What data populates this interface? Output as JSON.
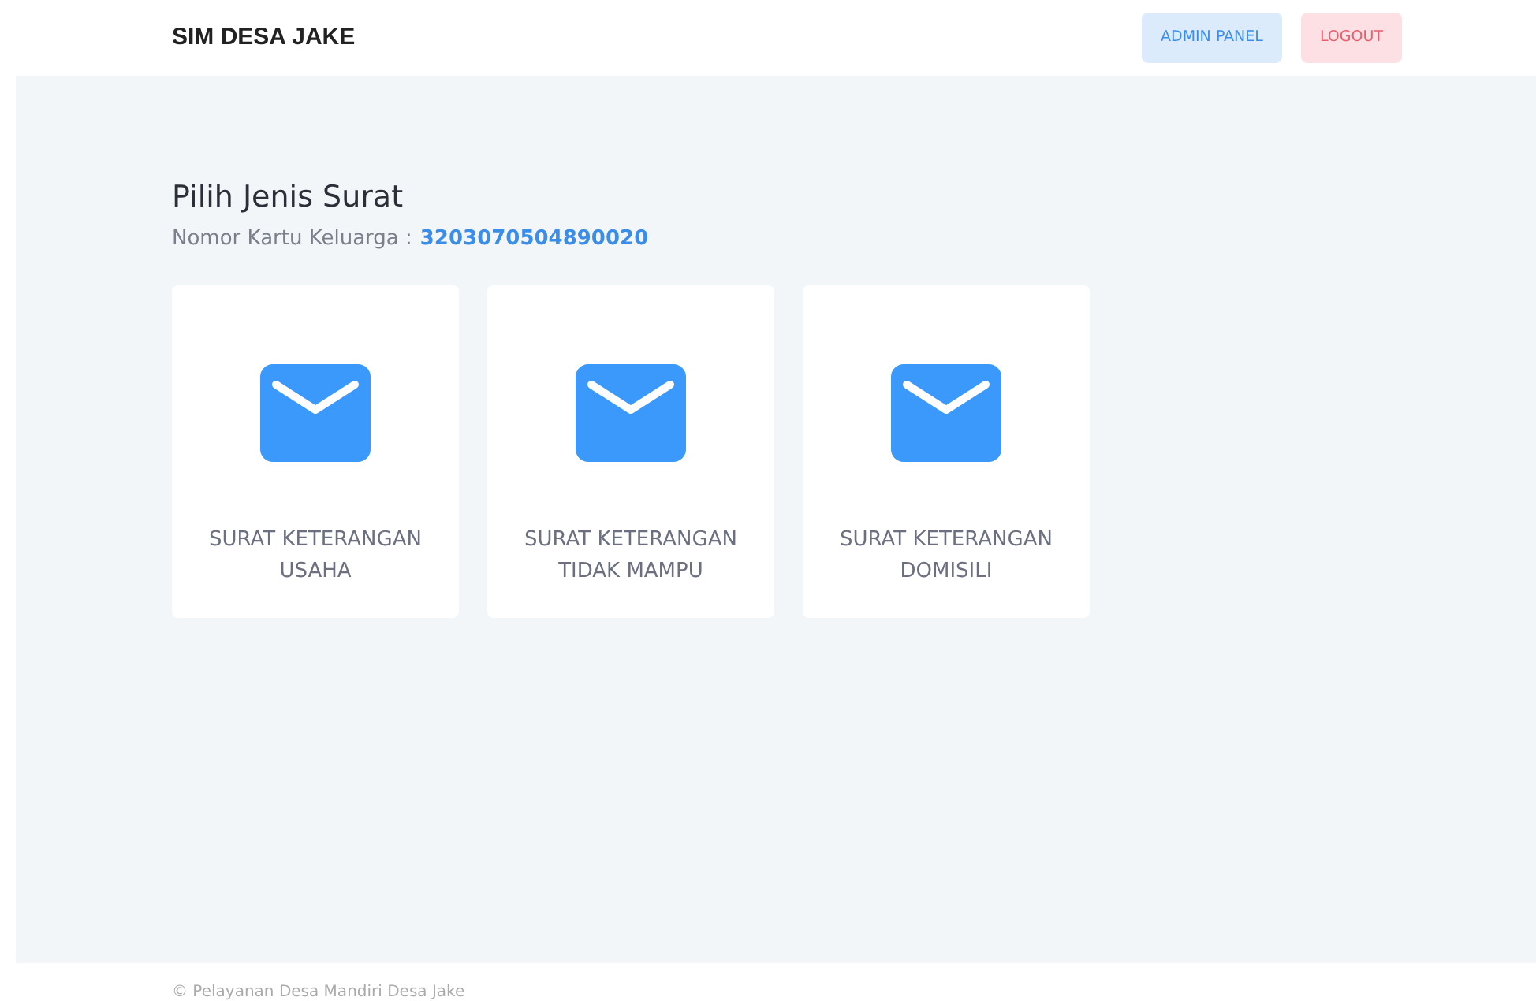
{
  "header": {
    "brand": "SIM DESA JAKE",
    "buttons": [
      {
        "label": "ADMIN PANEL",
        "kind": "primary"
      },
      {
        "label": "LOGOUT",
        "kind": "danger"
      }
    ]
  },
  "page": {
    "title": "Pilih Jenis Surat",
    "kk_label": "Nomor Kartu Keluarga :",
    "kk_number": "3203070504890020"
  },
  "cards": [
    {
      "label": "SURAT KETERANGAN USAHA"
    },
    {
      "label": "SURAT KETERANGAN TIDAK MAMPU"
    },
    {
      "label": "SURAT KETERANGAN DOMISILI"
    }
  ],
  "footer": {
    "text": "© Pelayanan Desa Mandiri Desa Jake"
  }
}
